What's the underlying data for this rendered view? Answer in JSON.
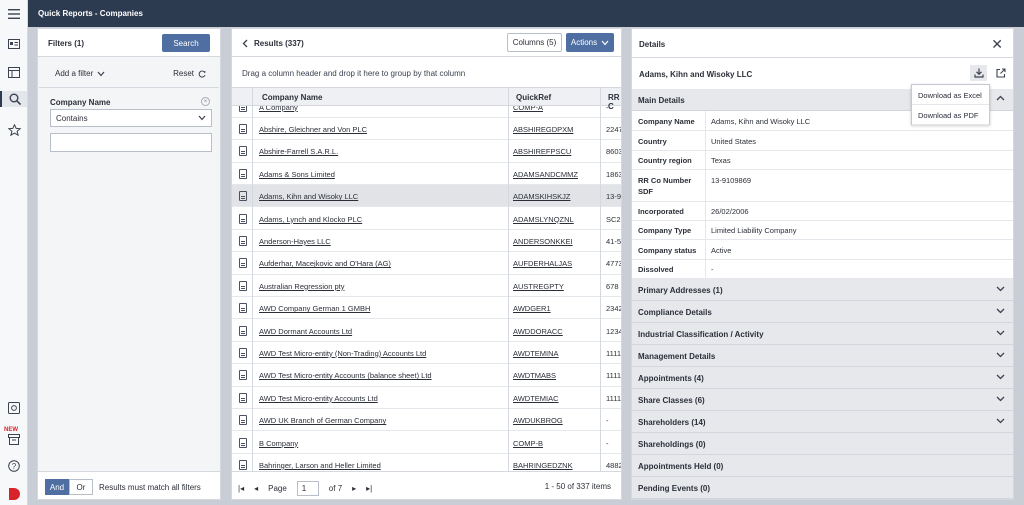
{
  "app": {
    "title": "Quick Reports - Companies",
    "new_badge": "NEW"
  },
  "rail": {
    "icons": [
      "menu-icon",
      "id-card-icon",
      "table-icon",
      "search-icon",
      "star-icon",
      "settings-icon",
      "archive-icon",
      "help-icon",
      "logo-icon"
    ]
  },
  "filters": {
    "title": "Filters (1)",
    "search_label": "Search",
    "add_filter_label": "Add a filter",
    "reset_label": "Reset",
    "field_label": "Company Name",
    "operator_value": "Contains",
    "text_value": "",
    "and_label": "And",
    "or_label": "Or",
    "match_text": "Results must match all filters"
  },
  "results": {
    "title": "Results (337)",
    "columns_label": "Columns (5)",
    "actions_label": "Actions",
    "group_hint": "Drag a column header and drop it here to group by that column",
    "headers": {
      "name": "Company Name",
      "ref": "QuickRef",
      "rr": "RR C"
    },
    "rows": [
      {
        "name": "A Company",
        "ref": "COMP-A",
        "rr": "-"
      },
      {
        "name": "Abshire, Gleichner and Von PLC",
        "ref": "ABSHIREGDPXM",
        "rr": "2247"
      },
      {
        "name": "Abshire-Farrell S.A.R.L.",
        "ref": "ABSHIREFPSCU",
        "rr": "8603"
      },
      {
        "name": "Adams & Sons Limited",
        "ref": "ADAMSANDCMMZ",
        "rr": "1863"
      },
      {
        "name": "Adams, Kihn and Wisoky LLC",
        "ref": "ADAMSKIHSKJZ",
        "rr": "13-9"
      },
      {
        "name": "Adams, Lynch and Klocko PLC",
        "ref": "ADAMSLYNQZNL",
        "rr": "SC27"
      },
      {
        "name": "Anderson-Hayes LLC",
        "ref": "ANDERSONKKEI",
        "rr": "41-5"
      },
      {
        "name": "Aufderhar, Macejkovic and O'Hara (AG)",
        "ref": "AUFDERHALJAS",
        "rr": "4773"
      },
      {
        "name": "Australian Regression pty",
        "ref": "AUSTREGPTY",
        "rr": "678 2"
      },
      {
        "name": "AWD Company German 1 GMBH",
        "ref": "AWDGER1",
        "rr": "2342"
      },
      {
        "name": "AWD Dormant Accounts Ltd",
        "ref": "AWDDORACC",
        "rr": "1234"
      },
      {
        "name": "AWD Test Micro-entity (Non-Trading) Accounts Ltd",
        "ref": "AWDTEMINA",
        "rr": "1111"
      },
      {
        "name": "AWD Test Micro-entity Accounts (balance sheet) Ltd",
        "ref": "AWDTMABS",
        "rr": "1111"
      },
      {
        "name": "AWD Test Micro-entity Accounts Ltd",
        "ref": "AWDTEMIAC",
        "rr": "1111"
      },
      {
        "name": "AWD UK Branch of German Company",
        "ref": "AWDUKBROG",
        "rr": "-"
      },
      {
        "name": "B Company",
        "ref": "COMP-B",
        "rr": "-"
      },
      {
        "name": "Bahringer, Larson and Heller Limited",
        "ref": "BAHRINGEDZNK",
        "rr": "4882"
      }
    ],
    "selected_row": 4,
    "page_label": "Page",
    "page_value": "1",
    "page_of": "of 7",
    "range_text": "1 - 50 of 337 items"
  },
  "details": {
    "title": "Details",
    "company": "Adams, Kihn and Wisoky LLC",
    "main_section": "Main Details",
    "fields": [
      {
        "k": "Company Name",
        "v": "Adams, Kihn and Wisoky LLC"
      },
      {
        "k": "Country",
        "v": "United States"
      },
      {
        "k": "Country region",
        "v": "Texas"
      },
      {
        "k": "RR Co Number SDF",
        "v": "13-9109869"
      },
      {
        "k": "Incorporated",
        "v": "26/02/2006"
      },
      {
        "k": "Company Type",
        "v": "Limited Liability Company"
      },
      {
        "k": "Company status",
        "v": "Active"
      },
      {
        "k": "Dissolved",
        "v": "-"
      }
    ],
    "sections": [
      {
        "label": "Primary Addresses (1)",
        "chevron": true
      },
      {
        "label": "Compliance Details",
        "chevron": true
      },
      {
        "label": "Industrial Classification / Activity",
        "chevron": true
      },
      {
        "label": "Management Details",
        "chevron": true
      },
      {
        "label": "Appointments (4)",
        "chevron": true
      },
      {
        "label": "Share Classes (6)",
        "chevron": true
      },
      {
        "label": "Shareholders (14)",
        "chevron": true
      },
      {
        "label": "Shareholdings (0)",
        "chevron": false
      },
      {
        "label": "Appointments Held (0)",
        "chevron": false
      },
      {
        "label": "Pending Events (0)",
        "chevron": false
      }
    ],
    "download_menu": [
      "Download as Excel",
      "Download as PDF"
    ]
  }
}
